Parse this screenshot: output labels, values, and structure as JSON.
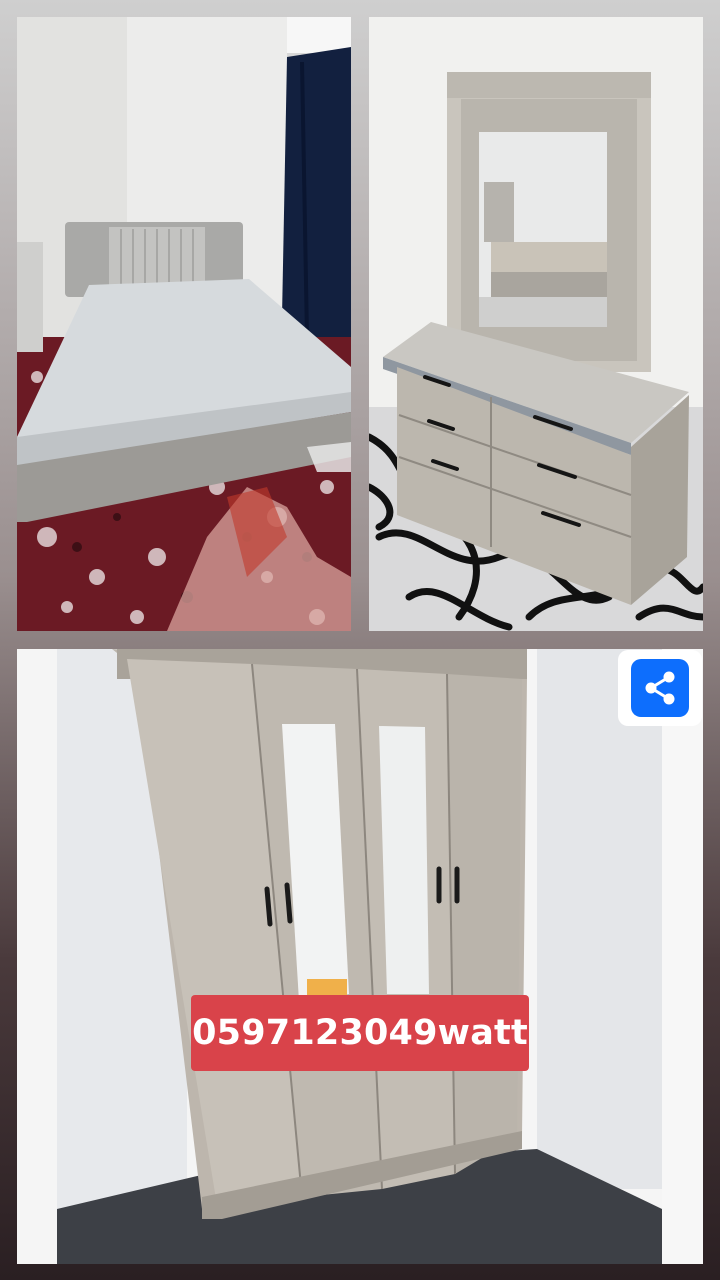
{
  "photos": [
    {
      "name": "bed-photo"
    },
    {
      "name": "dresser-photo"
    },
    {
      "name": "wardrobe-photo"
    }
  ],
  "overlay": {
    "phone_text": "0597123049watt"
  },
  "share": {
    "icon": "share-icon",
    "color": "#0d6efd"
  }
}
